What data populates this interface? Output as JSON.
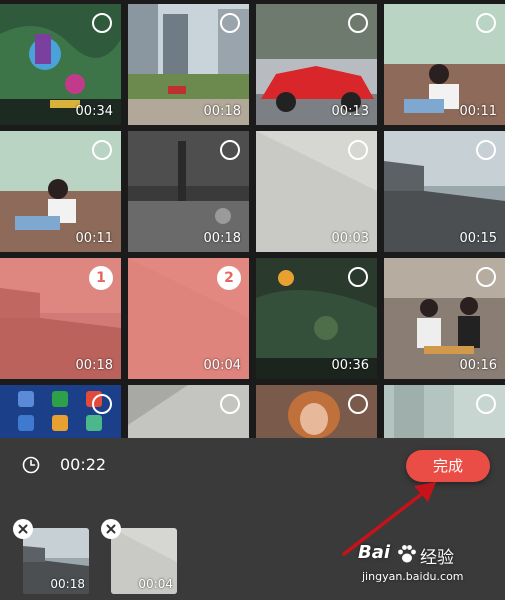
{
  "grid": {
    "cells": [
      {
        "duration": "00:34",
        "scene": "game-scene"
      },
      {
        "duration": "00:18",
        "scene": "city-scene"
      },
      {
        "duration": "00:13",
        "scene": "sports-car-scene"
      },
      {
        "duration": "00:11",
        "scene": "girl-sofa-scene"
      },
      {
        "duration": "00:11",
        "scene": "girl-sofa-scene"
      },
      {
        "duration": "00:18",
        "scene": "night-street-scene"
      },
      {
        "duration": "00:03",
        "scene": "wall-scene"
      },
      {
        "duration": "00:15",
        "scene": "car-interior-scene"
      },
      {
        "duration": "00:18",
        "scene": "car-interior-scene",
        "selected_index": "1"
      },
      {
        "duration": "00:04",
        "scene": "wall-scene",
        "selected_index": "2"
      },
      {
        "duration": "00:36",
        "scene": "game-scene"
      },
      {
        "duration": "00:16",
        "scene": "cafe-scene"
      },
      {
        "duration": "",
        "scene": "phone-screen-scene"
      },
      {
        "duration": "",
        "scene": "wall-scene"
      },
      {
        "duration": "",
        "scene": "woman-portrait-scene"
      },
      {
        "duration": "",
        "scene": "glass-wall-scene"
      }
    ]
  },
  "bottom": {
    "clock_icon": "clock-icon",
    "total_time": "00:22",
    "done_label": "完成",
    "done_color": "#ea4d45",
    "selected": [
      {
        "duration": "00:18",
        "scene": "car-interior-scene"
      },
      {
        "duration": "00:04",
        "scene": "wall-scene"
      }
    ]
  },
  "watermark": {
    "brand_prefix": "Bai",
    "brand_suffix": "经验",
    "url": "jingyan.baidu.com"
  },
  "colors": {
    "selected_overlay": "#e86a60",
    "panel_bg": "#3a3a3a"
  }
}
